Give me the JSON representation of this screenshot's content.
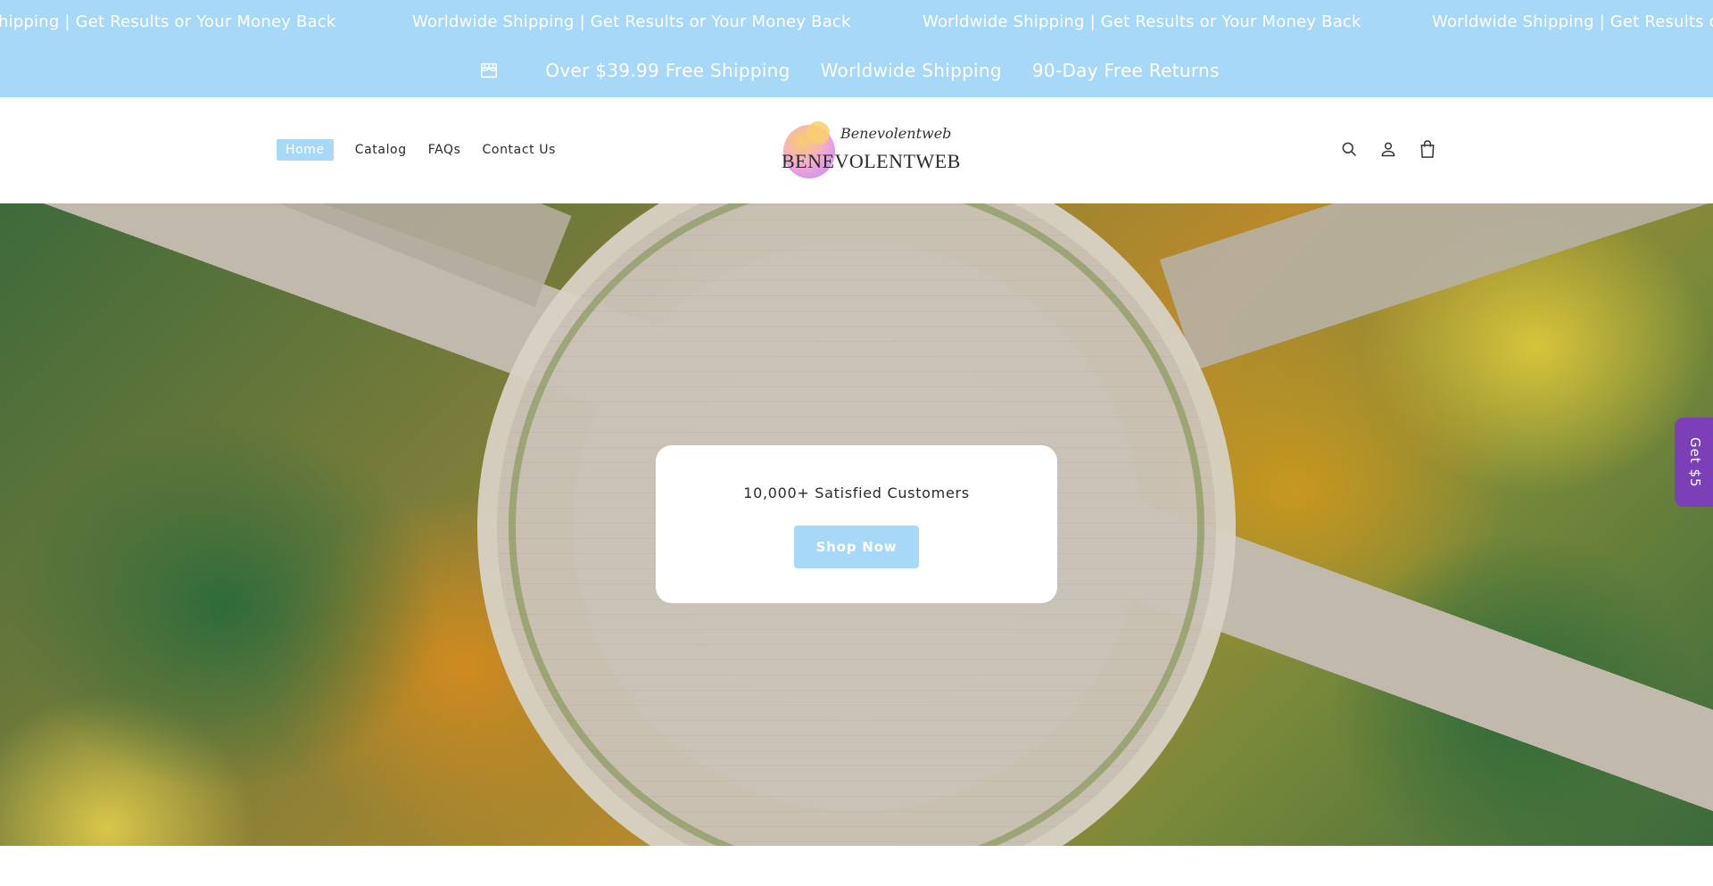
{
  "announcement": {
    "marquee": [
      "hipping | Get Results or Your Money Back",
      "Worldwide Shipping | Get Results or Your Money Back",
      "Worldwide Shipping | Get Results or Your Money Back",
      "Worldwide Shipping | Get Results or"
    ],
    "usps": [
      "Over $39.99 Free Shipping",
      "Worldwide Shipping",
      "90-Day Free Returns"
    ],
    "background_color": "#a8d8f8",
    "icon": "store-icon"
  },
  "header": {
    "nav": [
      "Home",
      "Catalog",
      "FAQs",
      "Contact Us"
    ],
    "active_nav": "Home",
    "logo": {
      "script": "Benevolentweb",
      "word": "BENEVOLENTWEB"
    },
    "icons": [
      "search-icon",
      "account-icon",
      "cart-icon"
    ]
  },
  "hero": {
    "promo_text": "10,000+ Satisfied Customers",
    "button_label": "Shop Now",
    "button_color": "#a8d8f8"
  },
  "side_tab": {
    "label": "Get $5",
    "color": "#7b3fb8"
  }
}
